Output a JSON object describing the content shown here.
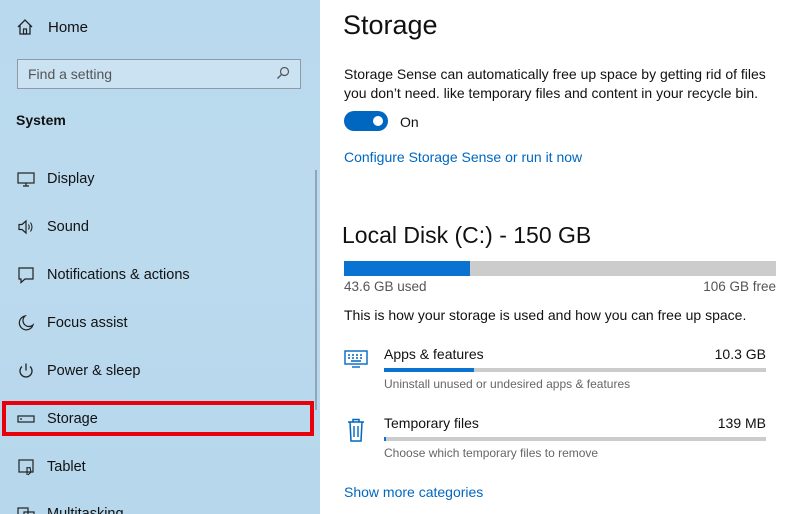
{
  "sidebar": {
    "home_label": "Home",
    "search_placeholder": "Find a setting",
    "section_title": "System",
    "items": [
      {
        "label": "Display",
        "icon": "monitor-icon"
      },
      {
        "label": "Sound",
        "icon": "speaker-icon"
      },
      {
        "label": "Notifications & actions",
        "icon": "notification-icon"
      },
      {
        "label": "Focus assist",
        "icon": "moon-icon"
      },
      {
        "label": "Power & sleep",
        "icon": "power-icon"
      },
      {
        "label": "Storage",
        "icon": "storage-icon",
        "selected": true
      },
      {
        "label": "Tablet",
        "icon": "tablet-icon"
      },
      {
        "label": "Multitasking",
        "icon": "multitasking-icon"
      }
    ]
  },
  "main": {
    "title": "Storage",
    "description": "Storage Sense can automatically free up space by getting rid of files you don’t need. like temporary files and content in your recycle bin.",
    "toggle_state": "On",
    "configure_link": "Configure Storage Sense or run it now",
    "disk": {
      "title": "Local Disk (C:) - 150 GB",
      "used_label": "43.6 GB used",
      "free_label": "106 GB free",
      "used_fraction": 0.291
    },
    "how_text": "This is how your storage is used and how you can free up space.",
    "categories": [
      {
        "name": "Apps & features",
        "size": "10.3 GB",
        "description": "Uninstall unused or undesired apps & features",
        "fraction": 0.236,
        "icon": "apps-icon"
      },
      {
        "name": "Temporary files",
        "size": "139 MB",
        "description": "Choose which temporary files to remove",
        "fraction": 0.004,
        "icon": "trash-icon"
      }
    ],
    "show_more_link": "Show more categories"
  },
  "colors": {
    "accent": "#0067c0",
    "selection_outline": "#e8000b",
    "bar_track": "#cccccc"
  }
}
